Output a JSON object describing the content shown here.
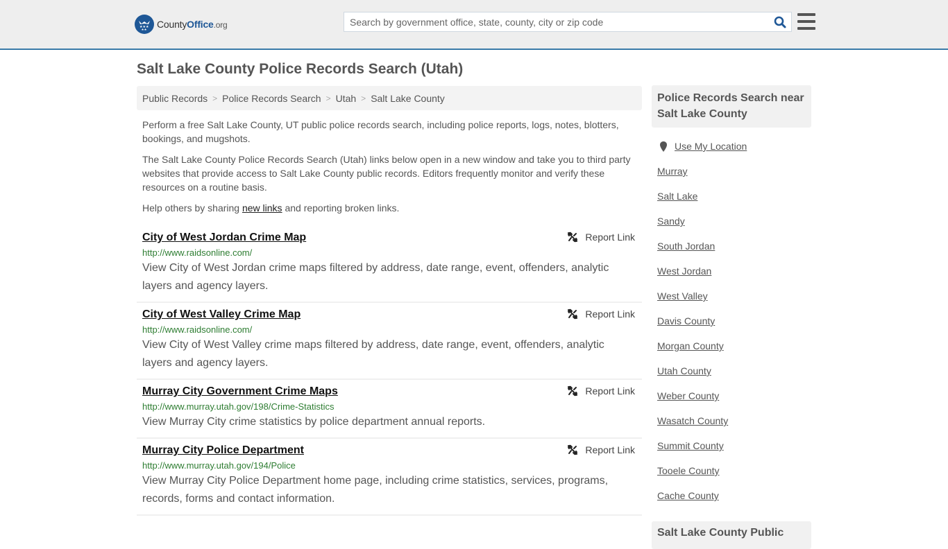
{
  "header": {
    "logo": {
      "part1": "County",
      "part2": "Office",
      "part3": ".org"
    },
    "search_placeholder": "Search by government office, state, county, city or zip code",
    "search_value": "",
    "brand_color": "#1e5796",
    "accent_border": "#3a7aa8"
  },
  "page": {
    "title": "Salt Lake County Police Records Search (Utah)"
  },
  "breadcrumb": [
    {
      "label": "Public Records"
    },
    {
      "label": "Police Records Search"
    },
    {
      "label": "Utah"
    },
    {
      "label": "Salt Lake County"
    }
  ],
  "intro": {
    "p1": "Perform a free Salt Lake County, UT public police records search, including police reports, logs, notes, blotters, bookings, and mugshots.",
    "p2": "The Salt Lake County Police Records Search (Utah) links below open in a new window and take you to third party websites that provide access to Salt Lake County public records. Editors frequently monitor and verify these resources on a routine basis.",
    "p3_before": "Help others by sharing ",
    "p3_link": "new links",
    "p3_after": " and reporting broken links."
  },
  "results": [
    {
      "title": "City of West Jordan Crime Map",
      "url": "http://www.raidsonline.com/",
      "description": "View City of West Jordan crime maps filtered by address, date range, event, offenders, analytic layers and agency layers.",
      "report_label": "Report Link"
    },
    {
      "title": "City of West Valley Crime Map",
      "url": "http://www.raidsonline.com/",
      "description": "View City of West Valley crime maps filtered by address, date range, event, offenders, analytic layers and agency layers.",
      "report_label": "Report Link"
    },
    {
      "title": "Murray City Government Crime Maps",
      "url": "http://www.murray.utah.gov/198/Crime-Statistics",
      "description": "View Murray City crime statistics by police department annual reports.",
      "report_label": "Report Link"
    },
    {
      "title": "Murray City Police Department",
      "url": "http://www.murray.utah.gov/194/Police",
      "description": "View Murray City Police Department home page, including crime statistics, services, programs, records, forms and contact information.",
      "report_label": "Report Link"
    }
  ],
  "sidebar": {
    "heading": "Police Records Search near Salt Lake County",
    "use_location": "Use My Location",
    "links": [
      "Murray",
      "Salt Lake",
      "Sandy",
      "South Jordan",
      "West Jordan",
      "West Valley",
      "Davis County",
      "Morgan County",
      "Utah County",
      "Weber County",
      "Wasatch County",
      "Summit County",
      "Tooele County",
      "Cache County"
    ],
    "heading2": "Salt Lake County Public"
  }
}
